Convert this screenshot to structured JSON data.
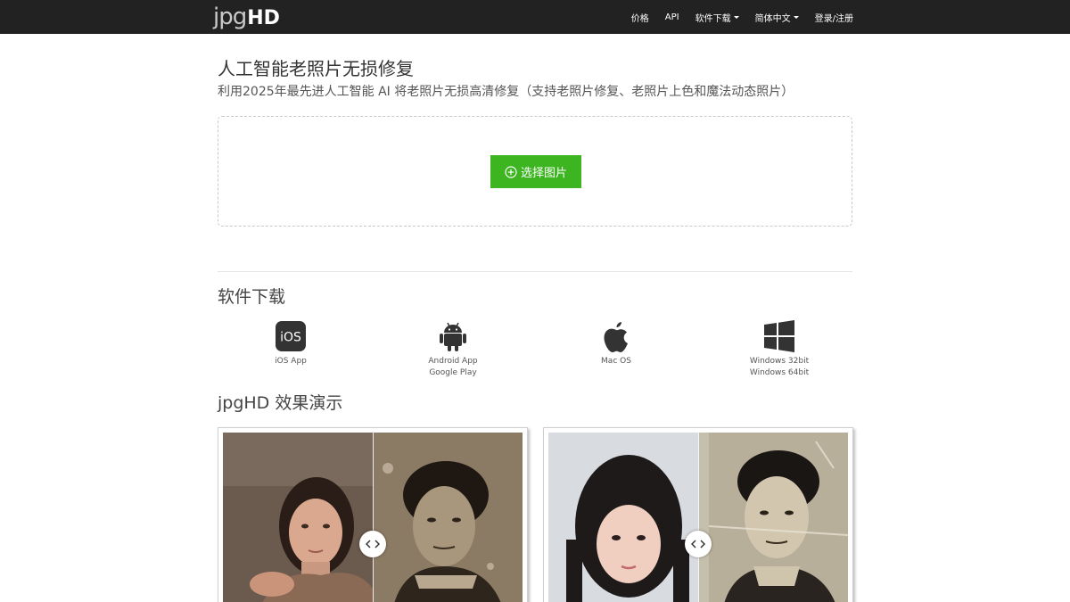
{
  "nav": {
    "brand_light": "jpg",
    "brand_bold": "HD",
    "items": [
      {
        "label": "价格",
        "dropdown": false
      },
      {
        "label": "API",
        "dropdown": false
      },
      {
        "label": "软件下载",
        "dropdown": true
      },
      {
        "label": "简体中文",
        "dropdown": true
      },
      {
        "label": "登录/注册",
        "dropdown": false
      }
    ]
  },
  "hero": {
    "title": "人工智能老照片无损修复",
    "subtitle": "利用2025年最先进人工智能 AI 将老照片无损高清修复（支持老照片修复、老照片上色和魔法动态照片）",
    "button_label": "选择图片",
    "button_icon": "plus-circle-icon"
  },
  "downloads": {
    "title": "软件下载",
    "items": [
      {
        "icon": "ios-icon",
        "lines": [
          "iOS App"
        ]
      },
      {
        "icon": "android-icon",
        "lines": [
          "Android App",
          "Google Play"
        ]
      },
      {
        "icon": "apple-icon",
        "lines": [
          "Mac OS"
        ]
      },
      {
        "icon": "windows-icon",
        "lines": [
          "Windows 32bit",
          "Windows 64bit"
        ]
      }
    ]
  },
  "demo": {
    "title": "jpgHD 效果演示",
    "cards": [
      {
        "before": "old-photo-man",
        "after": "restored-photo-woman"
      },
      {
        "before": "old-photo-man-2",
        "after": "restored-photo-girl"
      }
    ]
  },
  "colors": {
    "navbar": "#222222",
    "accent_green": "#3cb521"
  },
  "ios_text": "iOS"
}
